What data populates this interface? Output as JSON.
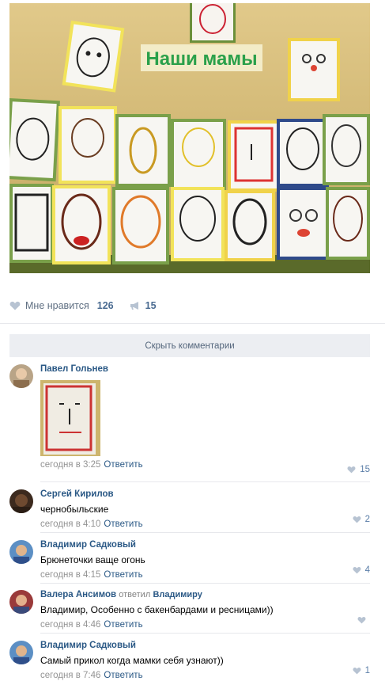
{
  "post": {
    "photo_banner_text": "Наши мамы",
    "likes_label": "Мне нравится",
    "likes_count": "126",
    "shares_count": "15",
    "hide_comments_label": "Скрыть комментарии"
  },
  "comments": [
    {
      "author": "Павел Гольнев",
      "text": "",
      "time": "сегодня в 3:25",
      "reply": "Ответить",
      "likes": "15",
      "has_image": true
    },
    {
      "author": "Сергей Кирилов",
      "text": "чернобыльские",
      "time": "сегодня в 4:10",
      "reply": "Ответить",
      "likes": "2"
    },
    {
      "author": "Владимир Садковый",
      "text": "Брюнеточки ваще огонь",
      "time": "сегодня в 4:15",
      "reply": "Ответить",
      "likes": "4"
    },
    {
      "author": "Валера Ансимов",
      "replied_prefix": "ответил",
      "replied_to": "Владимиру",
      "text": "Владимир, Особенно с бакенбардами и ресницами))",
      "time": "сегодня в 4:46",
      "reply": "Ответить",
      "likes": ""
    },
    {
      "author": "Владимир Садковый",
      "text": "Самый прикол когда мамки себя узнают))",
      "time": "сегодня в 7:46",
      "reply": "Ответить",
      "likes": "1"
    }
  ],
  "colors": {
    "link": "#2a5885",
    "meta": "#939393",
    "like_icon": "#b7c3d2"
  }
}
